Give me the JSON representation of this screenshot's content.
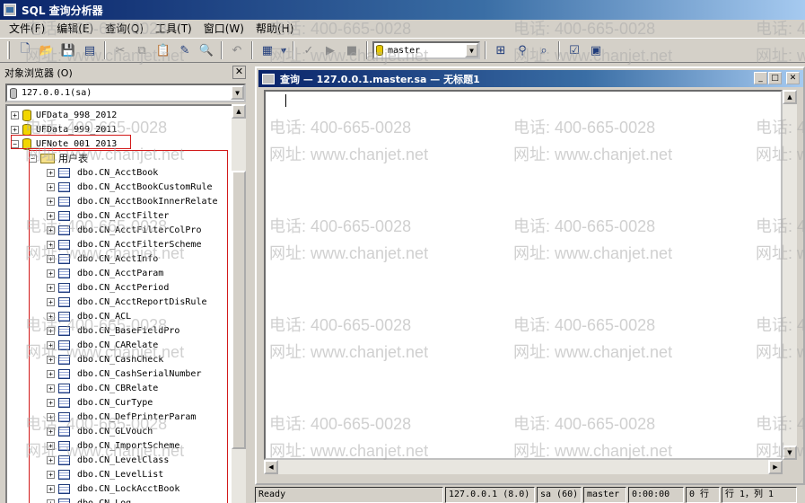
{
  "window": {
    "title": "SQL 查询分析器"
  },
  "menu": [
    "文件(F)",
    "编辑(E)",
    "查询(Q)",
    "工具(T)",
    "窗口(W)",
    "帮助(H)"
  ],
  "toolbar": {
    "database_selected": "master"
  },
  "object_browser": {
    "title": "对象浏览器 (O)",
    "server": "127.0.0.1(sa)",
    "databases": [
      "UFData_998_2012",
      "UFData_999_2011",
      "UFNote_001_2013"
    ],
    "folder": "用户表",
    "tables": [
      "dbo.CN_AcctBook",
      "dbo.CN_AcctBookCustomRule",
      "dbo.CN_AcctBookInnerRelate",
      "dbo.CN_AcctFilter",
      "dbo.CN_AcctFilterColPro",
      "dbo.CN_AcctFilterScheme",
      "dbo.CN_AcctInfo",
      "dbo.CN_AcctParam",
      "dbo.CN_AcctPeriod",
      "dbo.CN_AcctReportDisRule",
      "dbo.CN_ACL",
      "dbo.CN_BaseFieldPro",
      "dbo.CN_CARelate",
      "dbo.CN_CashCheck",
      "dbo.CN_CashSerialNumber",
      "dbo.CN_CBRelate",
      "dbo.CN_CurType",
      "dbo.CN_DefPrinterParam",
      "dbo.CN_GLVouch",
      "dbo.CN_ImportScheme",
      "dbo.CN_LevelClass",
      "dbo.CN_LevelList",
      "dbo.CN_LockAcctBook",
      "dbo.CN_Log"
    ]
  },
  "query_window": {
    "title": "查询 — 127.0.0.1.master.sa — 无标题1"
  },
  "status": {
    "ready": "Ready",
    "server": "127.0.0.1 (8.0)",
    "user": "sa (60)",
    "database": "master",
    "time": "0:00:00",
    "rows": "0 行",
    "position": "行 1，列 1"
  },
  "watermark": {
    "phone": "电话: 400-665-0028",
    "url": "网址: www.chanjet.net"
  }
}
